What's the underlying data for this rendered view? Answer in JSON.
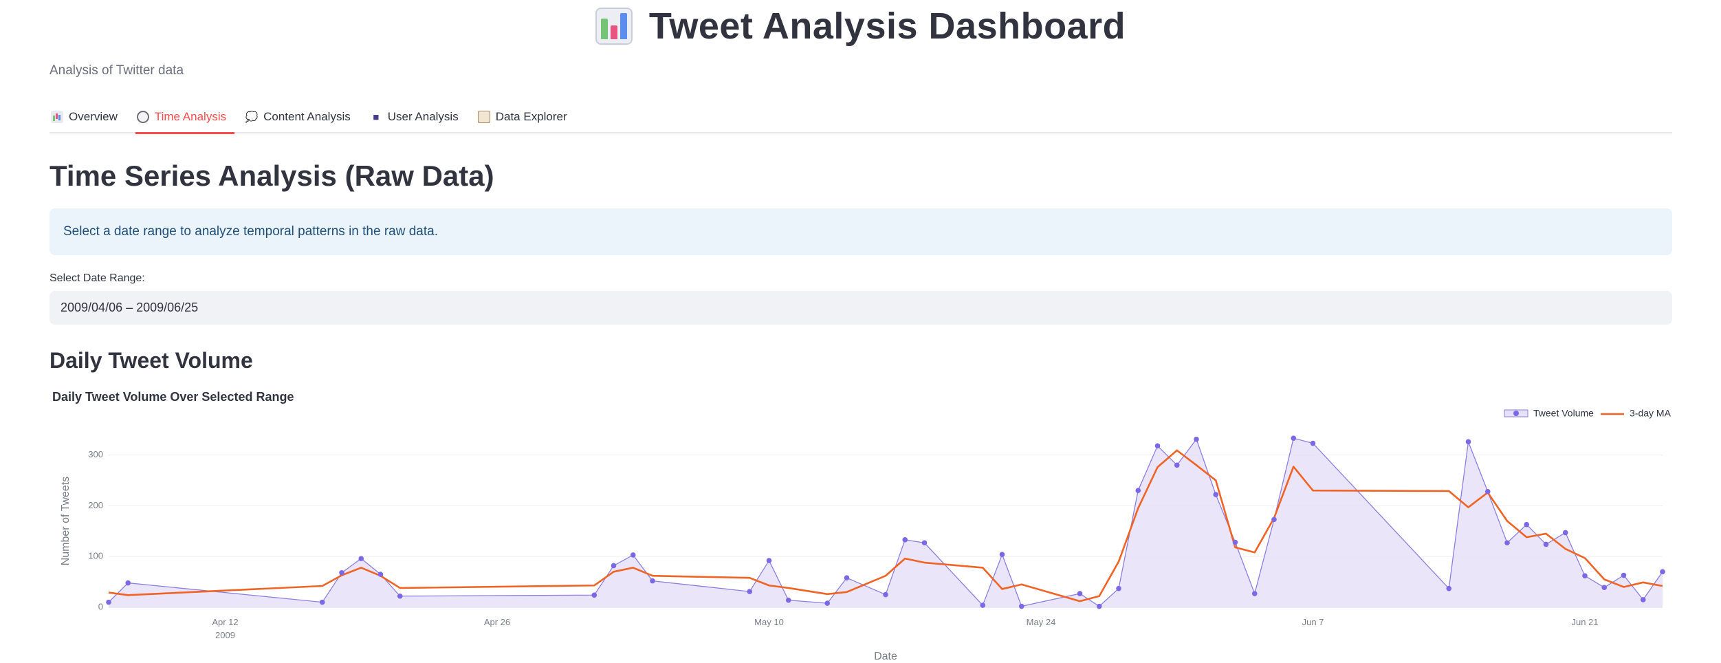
{
  "header": {
    "title": "Tweet Analysis Dashboard",
    "icon": "bar-chart-icon"
  },
  "subtitle": "Analysis of Twitter data",
  "tabs": [
    {
      "label": "Overview",
      "icon": "bar-chart-icon",
      "active": false
    },
    {
      "label": "Time Analysis",
      "icon": "clock-icon",
      "active": true
    },
    {
      "label": "Content Analysis",
      "icon": "speech-bubble-icon",
      "active": false
    },
    {
      "label": "User Analysis",
      "icon": "user-icon",
      "active": false
    },
    {
      "label": "Data Explorer",
      "icon": "clipboard-icon",
      "active": false
    }
  ],
  "section_title": "Time Series Analysis (Raw Data)",
  "info_message": "Select a date range to analyze temporal patterns in the raw data.",
  "date_range": {
    "label": "Select Date Range:",
    "value": "2009/04/06 – 2009/06/25"
  },
  "subsection_title": "Daily Tweet Volume",
  "colors": {
    "accent": "#ff4b4b",
    "volume_line": "#8b7fe0",
    "volume_fill": "#e6e0f8",
    "volume_marker": "#7b68e6",
    "ma_line": "#f06325"
  },
  "chart_data": {
    "type": "area",
    "title": "Daily Tweet Volume Over Selected Range",
    "xlabel": "Date",
    "ylabel": "Number of Tweets",
    "xlim": [
      "2009-04-06",
      "2009-06-25"
    ],
    "ylim": [
      0,
      340
    ],
    "yticks": [
      0,
      100,
      200,
      300
    ],
    "xticks": [
      {
        "date": "2009-04-12",
        "label": "Apr 12",
        "sublabel": "2009"
      },
      {
        "date": "2009-04-26",
        "label": "Apr 26",
        "sublabel": ""
      },
      {
        "date": "2009-05-10",
        "label": "May 10",
        "sublabel": ""
      },
      {
        "date": "2009-05-24",
        "label": "May 24",
        "sublabel": ""
      },
      {
        "date": "2009-06-07",
        "label": "Jun 7",
        "sublabel": ""
      },
      {
        "date": "2009-06-21",
        "label": "Jun 21",
        "sublabel": ""
      }
    ],
    "grid": true,
    "legend": "top-right",
    "series": [
      {
        "name": "Tweet Volume",
        "style": "area-with-markers",
        "x": [
          "2009-04-06",
          "2009-04-07",
          "2009-04-17",
          "2009-04-18",
          "2009-04-19",
          "2009-04-20",
          "2009-04-21",
          "2009-05-01",
          "2009-05-02",
          "2009-05-03",
          "2009-05-04",
          "2009-05-09",
          "2009-05-10",
          "2009-05-11",
          "2009-05-13",
          "2009-05-14",
          "2009-05-16",
          "2009-05-17",
          "2009-05-18",
          "2009-05-21",
          "2009-05-22",
          "2009-05-23",
          "2009-05-26",
          "2009-05-27",
          "2009-05-28",
          "2009-05-29",
          "2009-05-30",
          "2009-05-31",
          "2009-06-01",
          "2009-06-02",
          "2009-06-03",
          "2009-06-04",
          "2009-06-05",
          "2009-06-06",
          "2009-06-07",
          "2009-06-14",
          "2009-06-15",
          "2009-06-16",
          "2009-06-17",
          "2009-06-18",
          "2009-06-19",
          "2009-06-20",
          "2009-06-21",
          "2009-06-22",
          "2009-06-23",
          "2009-06-24",
          "2009-06-25"
        ],
        "values": [
          10,
          48,
          10,
          68,
          96,
          65,
          22,
          24,
          82,
          103,
          52,
          31,
          92,
          14,
          8,
          58,
          25,
          133,
          127,
          4,
          104,
          2,
          27,
          2,
          37,
          230,
          318,
          280,
          331,
          222,
          128,
          27,
          173,
          333,
          323,
          37,
          326,
          228,
          127,
          163,
          124,
          147,
          62,
          39,
          63,
          15,
          70
        ]
      },
      {
        "name": "3-day MA",
        "style": "line",
        "x": [
          "2009-04-06",
          "2009-04-07",
          "2009-04-17",
          "2009-04-18",
          "2009-04-19",
          "2009-04-20",
          "2009-04-21",
          "2009-05-01",
          "2009-05-02",
          "2009-05-03",
          "2009-05-04",
          "2009-05-09",
          "2009-05-10",
          "2009-05-11",
          "2009-05-13",
          "2009-05-14",
          "2009-05-16",
          "2009-05-17",
          "2009-05-18",
          "2009-05-21",
          "2009-05-22",
          "2009-05-23",
          "2009-05-26",
          "2009-05-27",
          "2009-05-28",
          "2009-05-29",
          "2009-05-30",
          "2009-05-31",
          "2009-06-01",
          "2009-06-02",
          "2009-06-03",
          "2009-06-04",
          "2009-06-05",
          "2009-06-06",
          "2009-06-07",
          "2009-06-14",
          "2009-06-15",
          "2009-06-16",
          "2009-06-17",
          "2009-06-18",
          "2009-06-19",
          "2009-06-20",
          "2009-06-21",
          "2009-06-22",
          "2009-06-23",
          "2009-06-24",
          "2009-06-25"
        ],
        "values": [
          29,
          24,
          42,
          63,
          78,
          62,
          38,
          43,
          70,
          78,
          62,
          58,
          43,
          38,
          26,
          30,
          62,
          96,
          88,
          78,
          36,
          45,
          12,
          22,
          90,
          195,
          276,
          309,
          280,
          250,
          118,
          108,
          176,
          277,
          230,
          229,
          197,
          226,
          170,
          138,
          145,
          115,
          97,
          55,
          40,
          49,
          42
        ]
      }
    ]
  }
}
